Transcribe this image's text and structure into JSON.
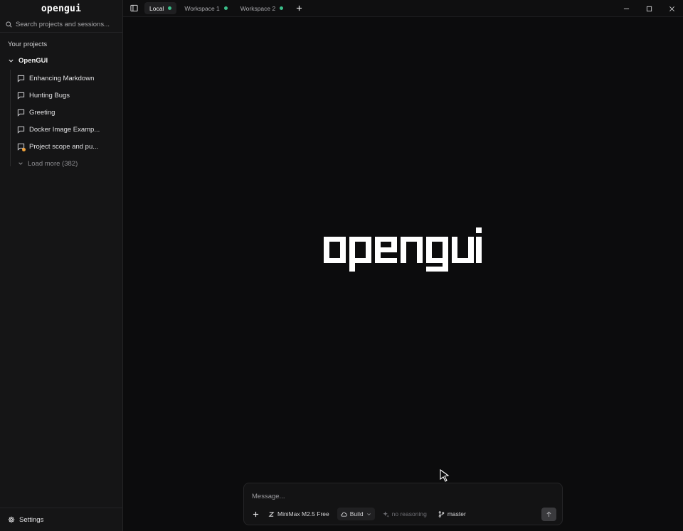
{
  "app": {
    "brand": "opengui"
  },
  "sidebar": {
    "search_placeholder": "Search projects and sessions...",
    "section_title": "Your projects",
    "project": {
      "name": "OpenGUI"
    },
    "sessions": [
      {
        "title": "Enhancing Markdown",
        "badge": false
      },
      {
        "title": "Hunting Bugs",
        "badge": false
      },
      {
        "title": "Greeting",
        "badge": false
      },
      {
        "title": "Docker Image Examp...",
        "badge": false
      },
      {
        "title": "Project scope and pu...",
        "badge": true,
        "badge_color": "#f0a23b"
      }
    ],
    "load_more": "Load more (382)",
    "settings_label": "Settings"
  },
  "tabs": [
    {
      "label": "Local",
      "active": true,
      "status_color": "#3bbf8a"
    },
    {
      "label": "Workspace 1",
      "active": false,
      "status_color": "#3bbf8a"
    },
    {
      "label": "Workspace 2",
      "active": false,
      "status_color": "#3bbf8a"
    }
  ],
  "composer": {
    "placeholder": "Message...",
    "model": "MiniMax M2.5 Free",
    "mode": "Build",
    "reasoning": "no reasoning",
    "branch": "master"
  },
  "colors": {
    "background": "#0c0c0d",
    "sidebar": "#151516",
    "status_green": "#3bbf8a",
    "badge_orange": "#f0a23b"
  }
}
